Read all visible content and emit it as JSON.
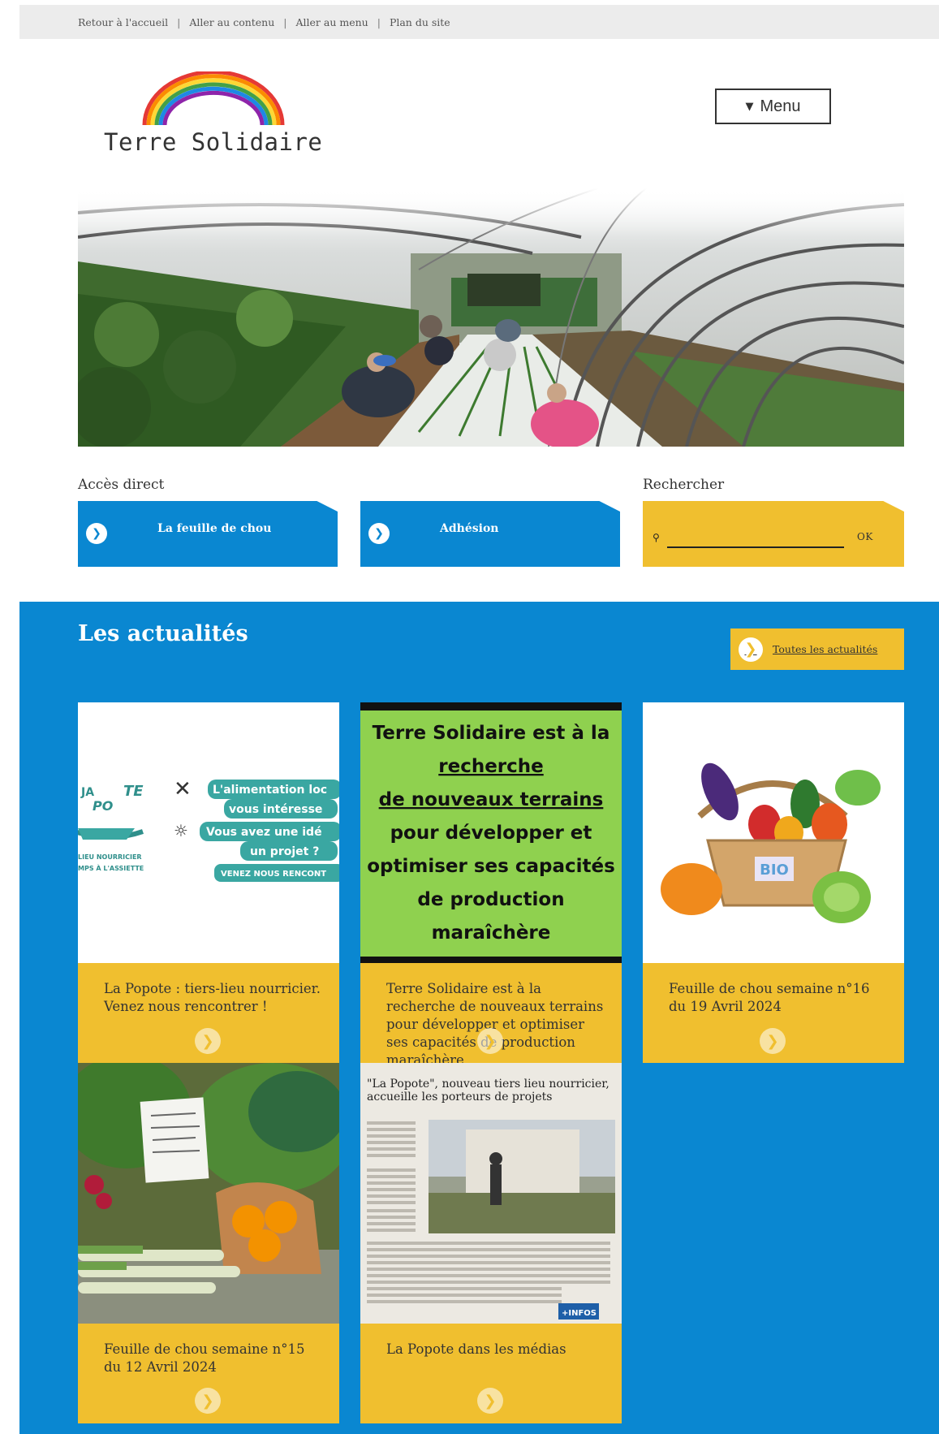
{
  "skip_links": {
    "home": "Retour à l'accueil",
    "content": "Aller au contenu",
    "menu": "Aller au menu",
    "sitemap": "Plan du site",
    "separator": "|"
  },
  "header": {
    "logo_text": "Terre Solidaire",
    "menu_label": "Menu",
    "menu_icon": "chevron-down-icon"
  },
  "direct_access": {
    "label": "Accès direct",
    "items": [
      {
        "label": "La feuille de chou",
        "icon": "chevron-right-icon"
      },
      {
        "label": "Adhésion",
        "icon": "chevron-right-icon"
      }
    ]
  },
  "search": {
    "label": "Rechercher",
    "placeholder": "",
    "button": "OK",
    "icon": "search-icon"
  },
  "news": {
    "title": "Les actualités",
    "all_label": "Toutes les actualités",
    "cards": [
      {
        "caption": "La Popote : tiers-lieu nourricier. Venez nous rencontrer !",
        "image_text": {
          "line1": "L'alimentation loc",
          "line2": "vous intéresse",
          "line3": "Vous avez une idé",
          "line4": "un projet ?",
          "cta": "VENEZ NOUS RENCONT",
          "sub1": "LIEU NOURRICIER",
          "sub2": "MPS À L'ASSIETTE"
        }
      },
      {
        "caption": "Terre Solidaire est à la recherche de nouveaux terrains pour développer et optimiser ses capacités de production maraîchère",
        "image_text": {
          "line1": "Terre Solidaire est à la",
          "line2": "recherche",
          "line3": "de nouveaux terrains",
          "line4": "pour développer et",
          "line5": "optimiser ses capacités",
          "line6": "de production",
          "line7": "maraîchère"
        }
      },
      {
        "caption": "Feuille de chou semaine n°16 du 19 Avril 2024",
        "image_text": {
          "label": "BIO"
        }
      },
      {
        "caption": "Feuille de chou semaine n°15 du 12 Avril 2024"
      },
      {
        "caption": "La Popote dans les médias",
        "image_text": {
          "headline": "\"La Popote\", nouveau tiers lieu nourricier, accueille les porteurs de projets",
          "badge": "+INFOS"
        }
      }
    ]
  },
  "colors": {
    "brand_blue": "#0a87d1",
    "brand_yellow": "#f0bf2f",
    "poster_green": "#8fd14f"
  }
}
